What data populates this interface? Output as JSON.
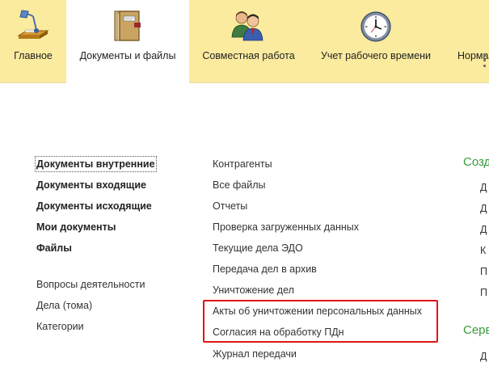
{
  "sections": [
    {
      "label": "Главное",
      "icon": "desk-lamp-icon"
    },
    {
      "label": "Документы и файлы",
      "icon": "binder-icon"
    },
    {
      "label": "Совместная работа",
      "icon": "people-icon"
    },
    {
      "label": "Учет рабочего времени",
      "icon": "clock-icon"
    },
    {
      "label": "Норма",
      "icon": "normative-icon"
    }
  ],
  "col1": {
    "bold_items": [
      "Документы внутренние",
      "Документы входящие",
      "Документы исходящие",
      "Мои документы",
      "Файлы"
    ],
    "items": [
      "Вопросы деятельности",
      "Дела (тома)",
      "Категории"
    ]
  },
  "col2": {
    "items": [
      "Контрагенты",
      "Все файлы",
      "Отчеты",
      "Проверка загруженных данных",
      "Текущие дела ЭДО",
      "Передача дел в архив",
      "Уничтожение дел",
      "Акты об уничтожении персональных данных",
      "Согласия на обработку ПДн",
      "Журнал передачи"
    ]
  },
  "col3": {
    "heading1": "Созд",
    "items1": [
      "Д",
      "Д",
      "Д",
      "К",
      "П",
      "П"
    ],
    "heading2": "Серв",
    "items2": [
      "Д"
    ]
  },
  "colors": {
    "topbar": "#fbeb9f",
    "green": "#3a9a3a",
    "highlight": "#e01515"
  }
}
